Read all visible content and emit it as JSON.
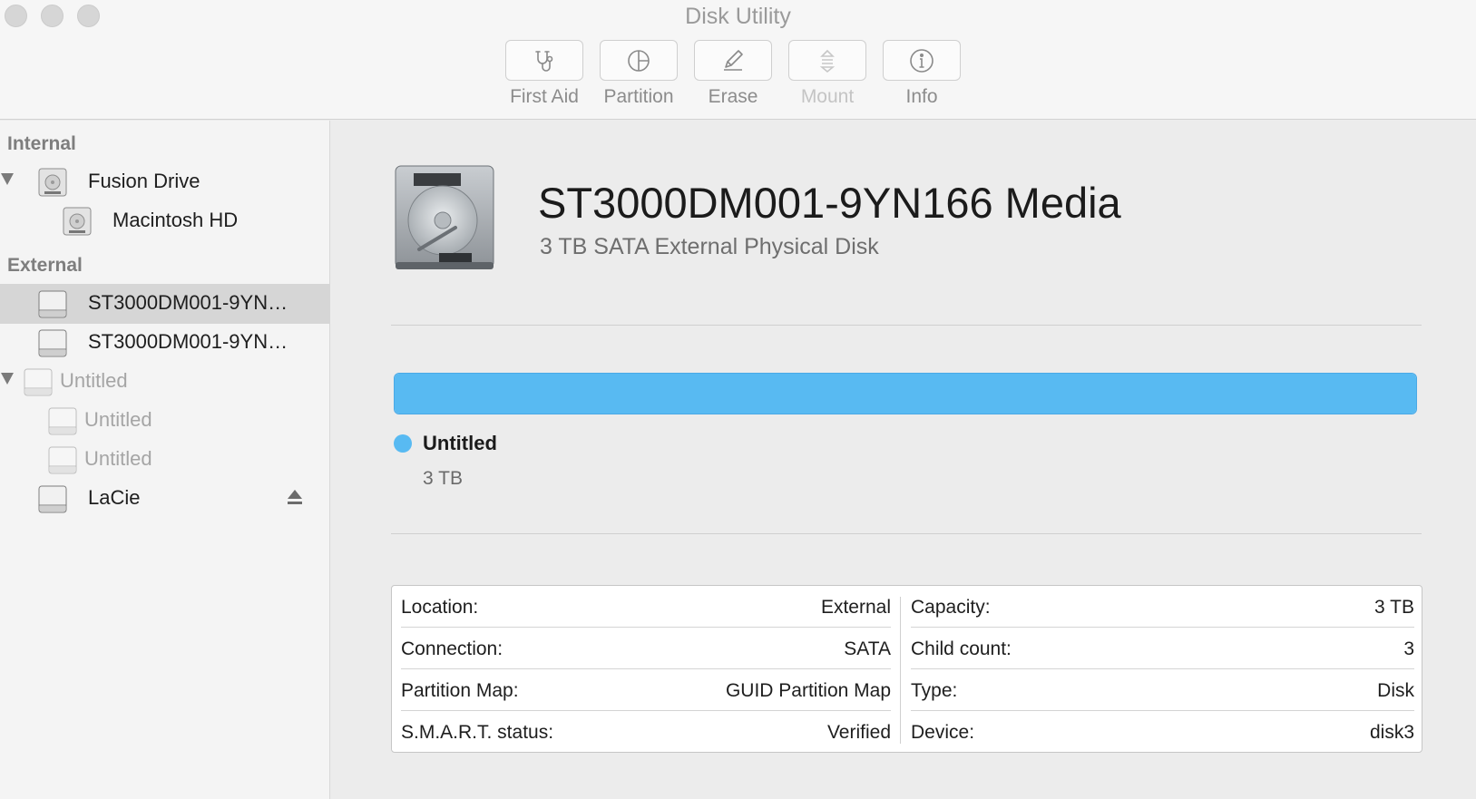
{
  "window": {
    "title": "Disk Utility"
  },
  "toolbar": {
    "first_aid": "First Aid",
    "partition": "Partition",
    "erase": "Erase",
    "mount": "Mount",
    "info": "Info"
  },
  "sidebar": {
    "internal_header": "Internal",
    "external_header": "External",
    "items": [
      {
        "label": "Fusion Drive",
        "icon": "internal-disk-icon",
        "expanded": true
      },
      {
        "label": "Macintosh HD",
        "icon": "internal-volume-icon"
      },
      {
        "label": "ST3000DM001-9YN…",
        "icon": "external-disk-icon",
        "selected": true
      },
      {
        "label": "ST3000DM001-9YN…",
        "icon": "external-disk-icon"
      },
      {
        "label": "Untitled",
        "icon": "external-disk-icon",
        "expanded": true,
        "dimmed": true
      },
      {
        "label": "Untitled",
        "icon": "external-volume-icon",
        "dimmed": true
      },
      {
        "label": "Untitled",
        "icon": "external-volume-icon",
        "dimmed": true
      },
      {
        "label": "LaCie",
        "icon": "external-disk-icon",
        "ejectable": true
      }
    ]
  },
  "detail": {
    "name": "ST3000DM001-9YN166 Media",
    "subtitle": "3 TB SATA External Physical Disk",
    "usage": {
      "fill_fraction": 1.0,
      "color": "#58baf2",
      "legend_name": "Untitled",
      "legend_size": "3 TB"
    },
    "info_left": [
      {
        "key": "Location:",
        "value": "External"
      },
      {
        "key": "Connection:",
        "value": "SATA"
      },
      {
        "key": "Partition Map:",
        "value": "GUID Partition Map"
      },
      {
        "key": "S.M.A.R.T. status:",
        "value": "Verified"
      }
    ],
    "info_right": [
      {
        "key": "Capacity:",
        "value": "3 TB"
      },
      {
        "key": "Child count:",
        "value": "3"
      },
      {
        "key": "Type:",
        "value": "Disk"
      },
      {
        "key": "Device:",
        "value": "disk3"
      }
    ]
  }
}
